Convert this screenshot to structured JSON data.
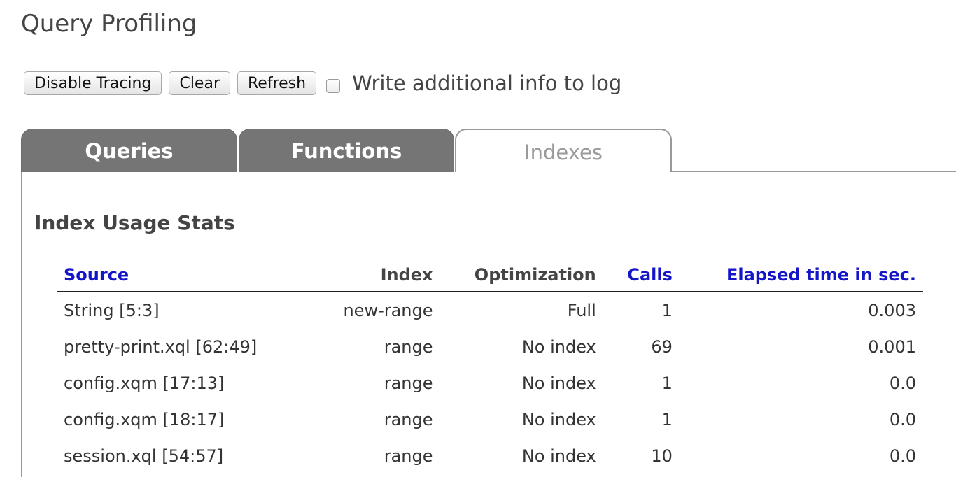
{
  "page": {
    "title": "Query Profiling"
  },
  "toolbar": {
    "disable_tracing_label": "Disable Tracing",
    "clear_label": "Clear",
    "refresh_label": "Refresh",
    "checkbox_checked": false,
    "checkbox_label": "Write additional info to log"
  },
  "tabs": [
    {
      "label": "Queries",
      "active": false
    },
    {
      "label": "Functions",
      "active": false
    },
    {
      "label": "Indexes",
      "active": true
    }
  ],
  "index_stats": {
    "title": "Index Usage Stats",
    "columns": {
      "source": "Source",
      "index": "Index",
      "optimization": "Optimization",
      "calls": "Calls",
      "elapsed": "Elapsed time in sec."
    },
    "rows": [
      {
        "source": "String [5:3]",
        "index": "new-range",
        "optimization": "Full",
        "calls": "1",
        "elapsed": "0.003"
      },
      {
        "source": "pretty-print.xql [62:49]",
        "index": "range",
        "optimization": "No index",
        "calls": "69",
        "elapsed": "0.001"
      },
      {
        "source": "config.xqm [17:13]",
        "index": "range",
        "optimization": "No index",
        "calls": "1",
        "elapsed": "0.0"
      },
      {
        "source": "config.xqm [18:17]",
        "index": "range",
        "optimization": "No index",
        "calls": "1",
        "elapsed": "0.0"
      },
      {
        "source": "session.xql [54:57]",
        "index": "range",
        "optimization": "No index",
        "calls": "10",
        "elapsed": "0.0"
      }
    ]
  },
  "colors": {
    "link_header": "#1515c8",
    "inactive_tab": "#757575",
    "active_tab_text": "#9a9a9a"
  }
}
